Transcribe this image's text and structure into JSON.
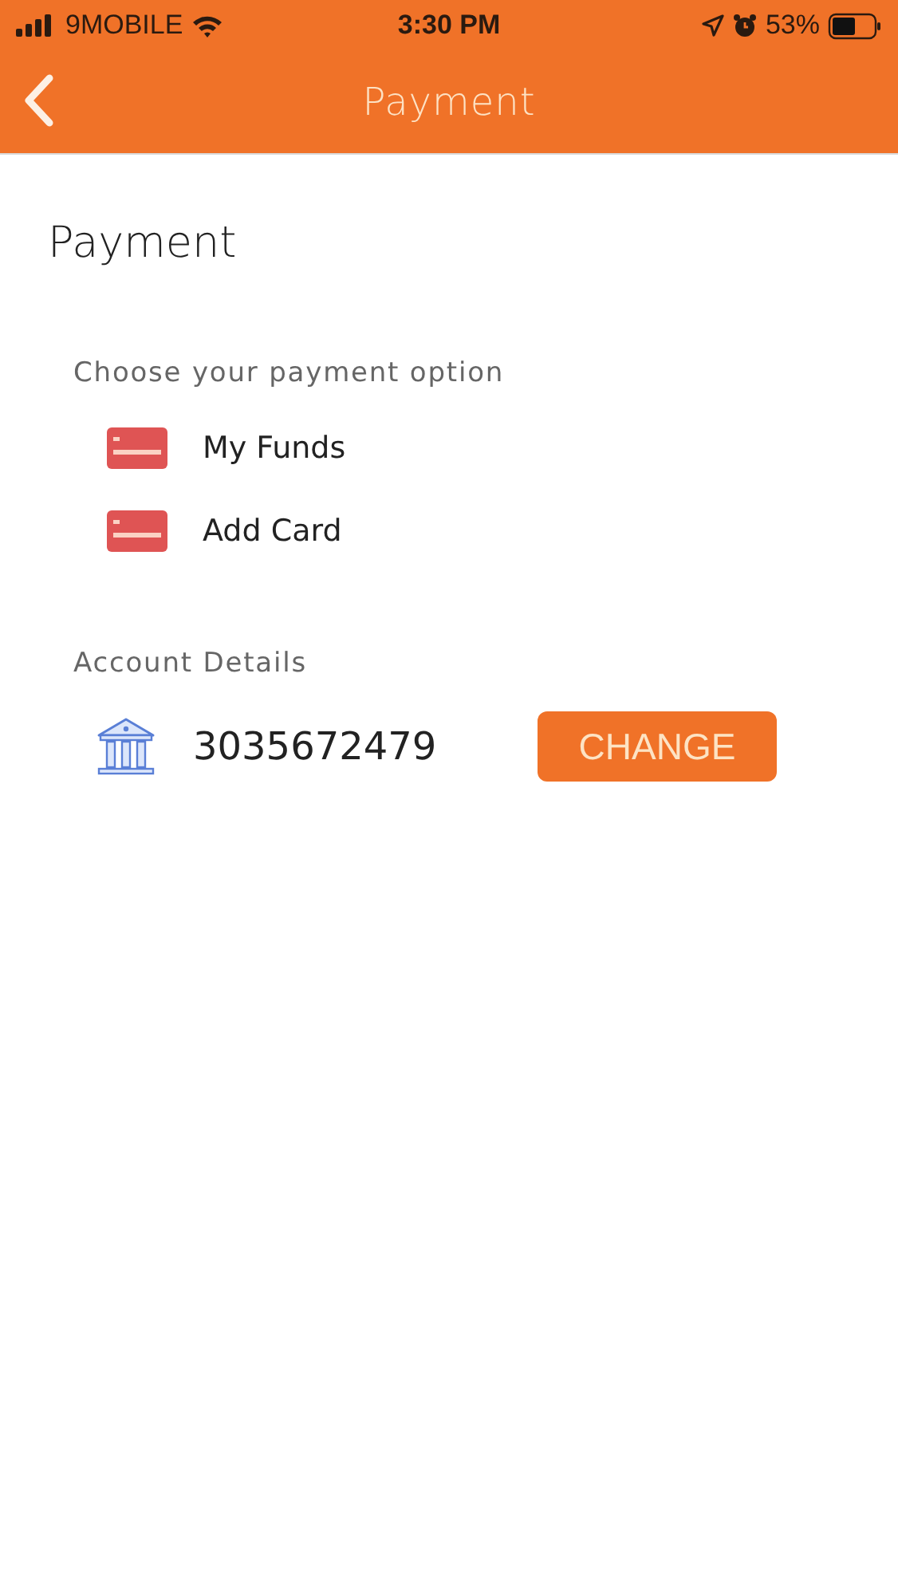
{
  "status_bar": {
    "carrier": "9MOBILE",
    "time": "3:30 PM",
    "battery": "53%"
  },
  "nav_bar": {
    "title": "Payment"
  },
  "heading": "Payment",
  "payment_options": {
    "label": "Choose your payment option",
    "items": [
      {
        "label": "My Funds"
      },
      {
        "label": "Add Card"
      }
    ]
  },
  "account_details": {
    "label": "Account Details",
    "account_number": "3035672479",
    "button": "CHANGE"
  }
}
